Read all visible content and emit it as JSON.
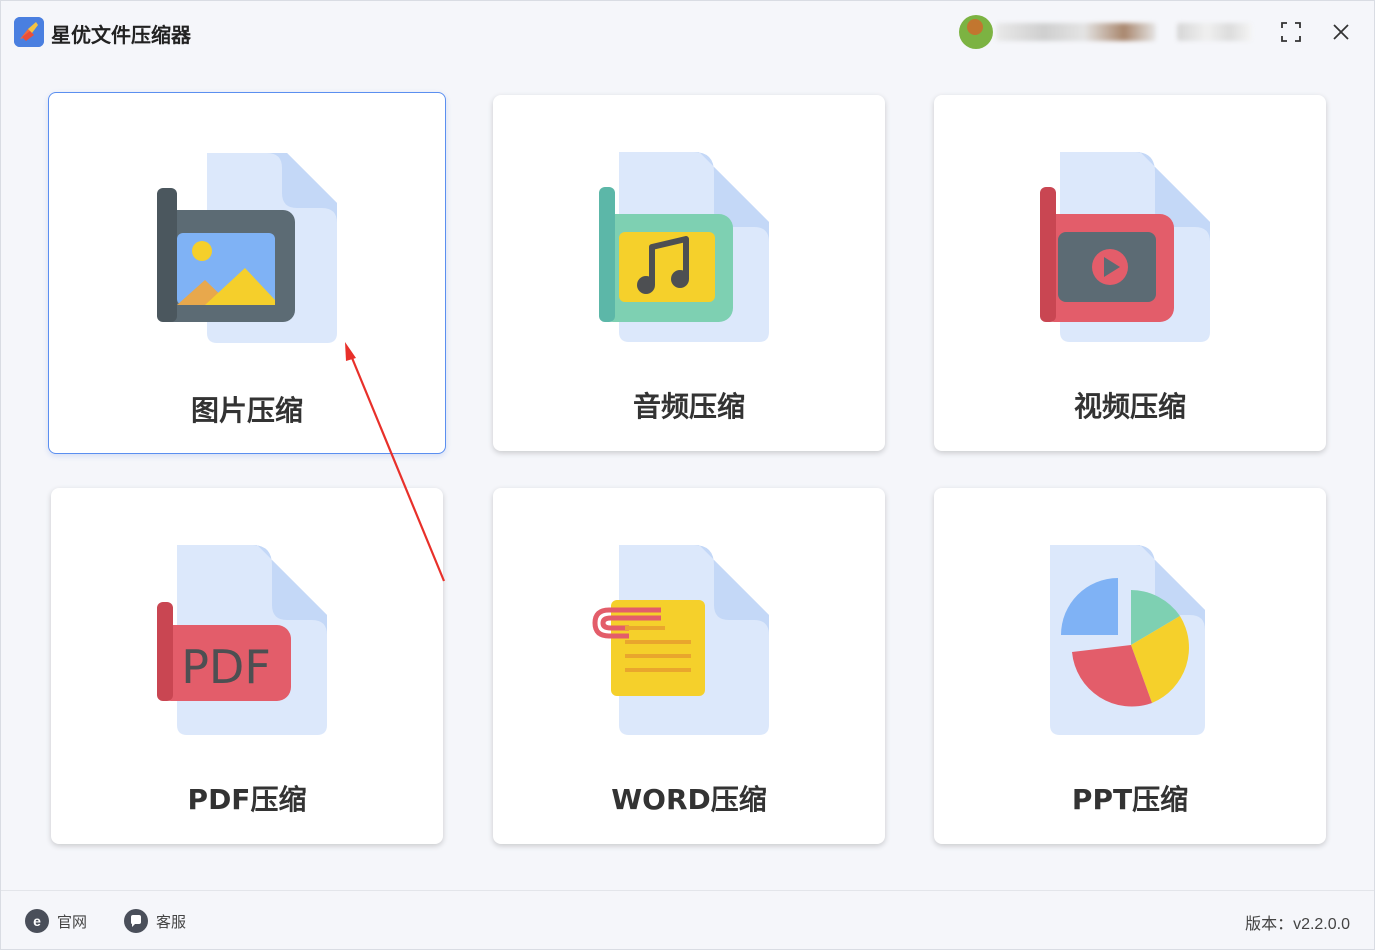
{
  "app": {
    "title": "星优文件压缩器"
  },
  "window_controls": {
    "maximize_icon": "maximize-icon",
    "close_icon": "close-icon"
  },
  "cards": [
    {
      "label": "图片压缩",
      "icon": "image-file-icon"
    },
    {
      "label": "音频压缩",
      "icon": "audio-file-icon"
    },
    {
      "label": "视频压缩",
      "icon": "video-file-icon"
    },
    {
      "label": "PDF压缩",
      "icon": "pdf-file-icon",
      "icon_text": "PDF"
    },
    {
      "label": "WORD压缩",
      "icon": "word-file-icon"
    },
    {
      "label": "PPT压缩",
      "icon": "ppt-file-icon"
    }
  ],
  "footer": {
    "website_label": "官网",
    "support_label": "客服",
    "version_label": "版本：v2.2.0.0"
  },
  "colors": {
    "accent": "#5b8ff0",
    "arrow": "#e8302a",
    "doc_back": "#dce8fb",
    "doc_fold": "#c4d8f7"
  }
}
